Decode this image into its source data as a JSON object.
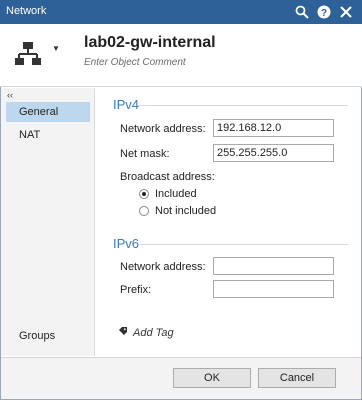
{
  "window": {
    "title": "Network"
  },
  "titlebar": {
    "search_icon": "search-icon",
    "help_icon": "help-icon",
    "close_icon": "close-icon"
  },
  "object": {
    "name": "lab02-gw-internal",
    "comment_placeholder": "Enter Object Comment",
    "icon": "network-topology-icon"
  },
  "sidebar": {
    "collapse_glyph": "‹‹",
    "items": [
      {
        "label": "General",
        "active": true
      },
      {
        "label": "NAT",
        "active": false
      }
    ],
    "bottom_item": {
      "label": "Groups"
    }
  },
  "ipv4": {
    "title": "IPv4",
    "network_address_label": "Network address:",
    "network_address_value": "192.168.12.0",
    "net_mask_label": "Net mask:",
    "net_mask_value": "255.255.255.0",
    "broadcast_label": "Broadcast address:",
    "broadcast_options": [
      {
        "label": "Included",
        "checked": true
      },
      {
        "label": "Not included",
        "checked": false
      }
    ]
  },
  "ipv6": {
    "title": "IPv6",
    "network_address_label": "Network address:",
    "network_address_value": "",
    "prefix_label": "Prefix:",
    "prefix_value": ""
  },
  "tags": {
    "add_label": "Add Tag",
    "icon": "tag-icon"
  },
  "buttons": {
    "ok": "OK",
    "cancel": "Cancel"
  },
  "colors": {
    "titlebar": "#2d6197",
    "section_title": "#3a78bf",
    "selected_item": "#bcd7ee"
  }
}
